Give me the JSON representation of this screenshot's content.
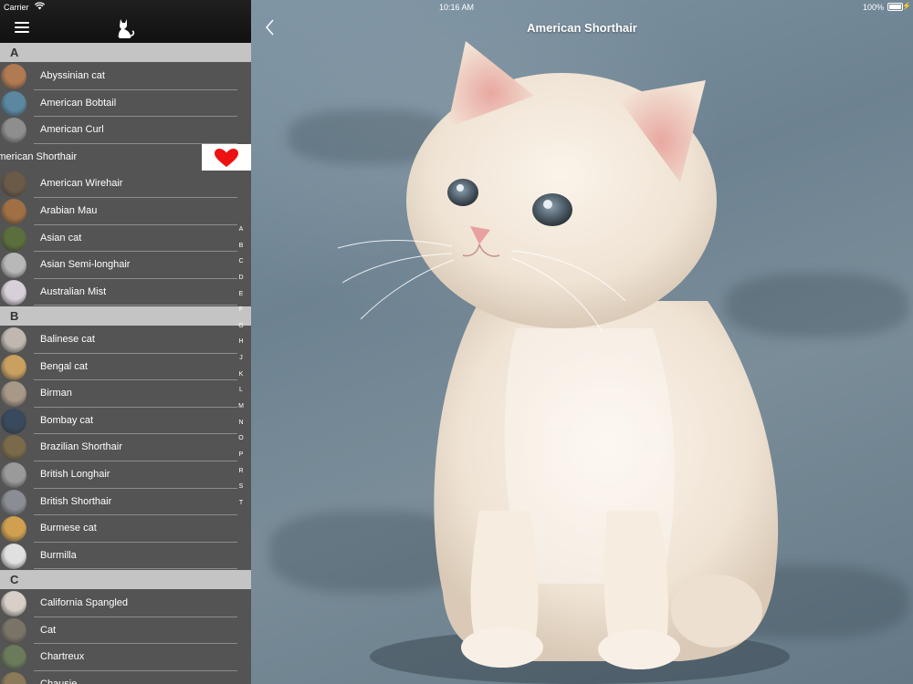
{
  "status_bar": {
    "carrier": "Carrier",
    "time": "10:16 AM",
    "battery": "100%"
  },
  "detail": {
    "title": "American Shorthair",
    "back_icon": "chevron-left-icon",
    "image_subject": "white kitten sitting on blue-gray blanket"
  },
  "sidebar": {
    "menu_icon": "hamburger-menu-icon",
    "logo_icon": "cat-silhouette-icon",
    "sections": [
      {
        "letter": "A",
        "items": [
          {
            "label": "Abyssinian cat",
            "color": "#b07a52"
          },
          {
            "label": "American Bobtail",
            "color": "#5b87a0"
          },
          {
            "label": "American Curl",
            "color": "#8e8e8e"
          },
          {
            "label": "American Shorthair",
            "color": "#e8e0d8",
            "swiped": true,
            "action_icon": "heart-icon"
          },
          {
            "label": "American Wirehair",
            "color": "#6b5a48"
          },
          {
            "label": "Arabian Mau",
            "color": "#a07044"
          },
          {
            "label": "Asian cat",
            "color": "#5b6e3e"
          },
          {
            "label": "Asian Semi-longhair",
            "color": "#b8b8b8"
          },
          {
            "label": "Australian Mist",
            "color": "#d8d0d8"
          }
        ]
      },
      {
        "letter": "B",
        "items": [
          {
            "label": "Balinese cat",
            "color": "#c0b8b0"
          },
          {
            "label": "Bengal cat",
            "color": "#c9a060"
          },
          {
            "label": "Birman",
            "color": "#a89888"
          },
          {
            "label": "Bombay cat",
            "color": "#3a4a5e"
          },
          {
            "label": "Brazilian Shorthair",
            "color": "#7a6a4a"
          },
          {
            "label": "British Longhair",
            "color": "#9a9a9a"
          },
          {
            "label": "British Shorthair",
            "color": "#8a8e94"
          },
          {
            "label": "Burmese cat",
            "color": "#d0a050"
          },
          {
            "label": "Burmilla",
            "color": "#e0e0e0"
          }
        ]
      },
      {
        "letter": "C",
        "items": [
          {
            "label": "California Spangled",
            "color": "#d8d0c8"
          },
          {
            "label": "Cat",
            "color": "#7a7468"
          },
          {
            "label": "Chartreux",
            "color": "#6a7a5a"
          },
          {
            "label": "Chausie",
            "color": "#8a7a5a"
          }
        ]
      }
    ],
    "index_letters": [
      "A",
      "B",
      "C",
      "D",
      "E",
      "F",
      "G",
      "H",
      "J",
      "K",
      "L",
      "M",
      "N",
      "O",
      "P",
      "R",
      "S",
      "T"
    ]
  },
  "colors": {
    "sidebar_bg": "#545454",
    "section_header_bg": "#c4c4c4",
    "favorite_heart": "#ee1111"
  }
}
